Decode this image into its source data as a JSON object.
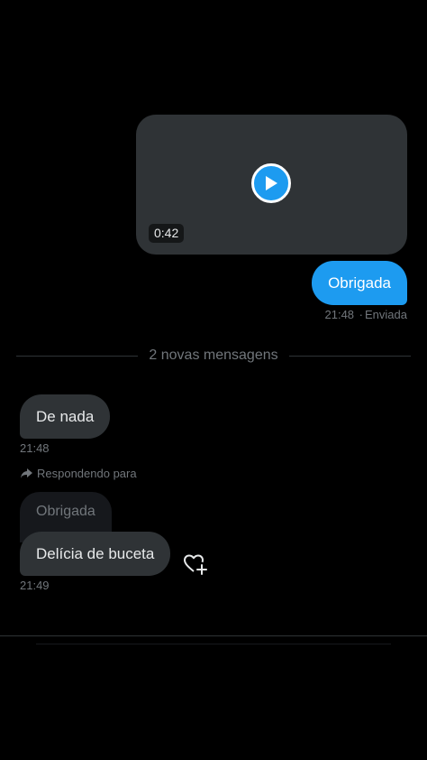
{
  "video_message": {
    "duration": "0:42",
    "play_icon": "play-icon"
  },
  "outgoing_message": {
    "text": "Obrigada",
    "time": "21:48",
    "status": "Enviada"
  },
  "divider": {
    "label": "2 novas mensagens"
  },
  "incoming_messages": [
    {
      "text": "De nada",
      "time": "21:48"
    },
    {
      "reply_label": "Respondendo para",
      "quoted_text": "Obrigada",
      "text": "Delícia de buceta",
      "time": "21:49",
      "reaction_icon": "heart-plus-icon"
    }
  ],
  "colors": {
    "background": "#000000",
    "bubble_incoming": "#2f3336",
    "bubble_outgoing": "#1d9bf0",
    "muted_text": "#71767b"
  }
}
